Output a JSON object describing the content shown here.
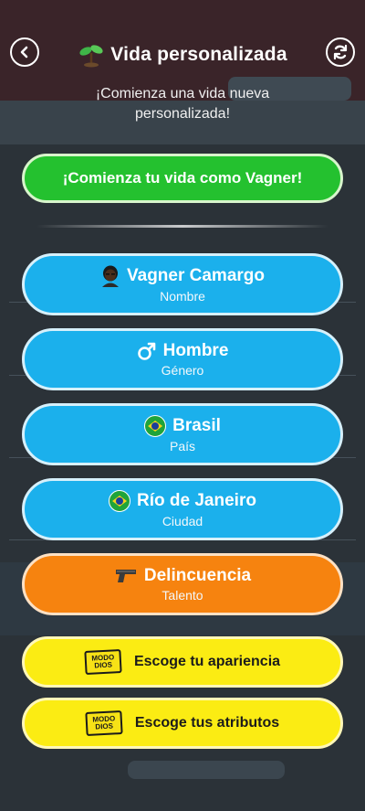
{
  "header": {
    "title": "Vida personalizada",
    "subtitle": "¡Comienza una vida nueva personalizada!",
    "back_icon": "chevron-left-icon",
    "refresh_icon": "refresh-icon",
    "title_icon": "sprout-icon"
  },
  "start_button": {
    "label": "¡Comienza tu vida como Vagner!"
  },
  "options": {
    "name": {
      "value": "Vagner Camargo",
      "caption": "Nombre",
      "icon": "avatar-icon"
    },
    "gender": {
      "value": "Hombre",
      "caption": "Género",
      "icon": "male-symbol-icon"
    },
    "country": {
      "value": "Brasil",
      "caption": "País",
      "icon": "brazil-flag-icon"
    },
    "city": {
      "value": "Río de Janeiro",
      "caption": "Ciudad",
      "icon": "brazil-flag-icon"
    },
    "talent": {
      "value": "Delincuencia",
      "caption": "Talento",
      "icon": "pistol-icon"
    }
  },
  "god_mode": {
    "badge_line1": "MODO",
    "badge_line2": "DIOS",
    "appearance_label": "Escoge tu apariencia",
    "attributes_label": "Escoge tus atributos"
  },
  "colors": {
    "green": "#24c12f",
    "blue": "#1bb0ec",
    "orange": "#f6830f",
    "yellow": "#fbec13"
  }
}
